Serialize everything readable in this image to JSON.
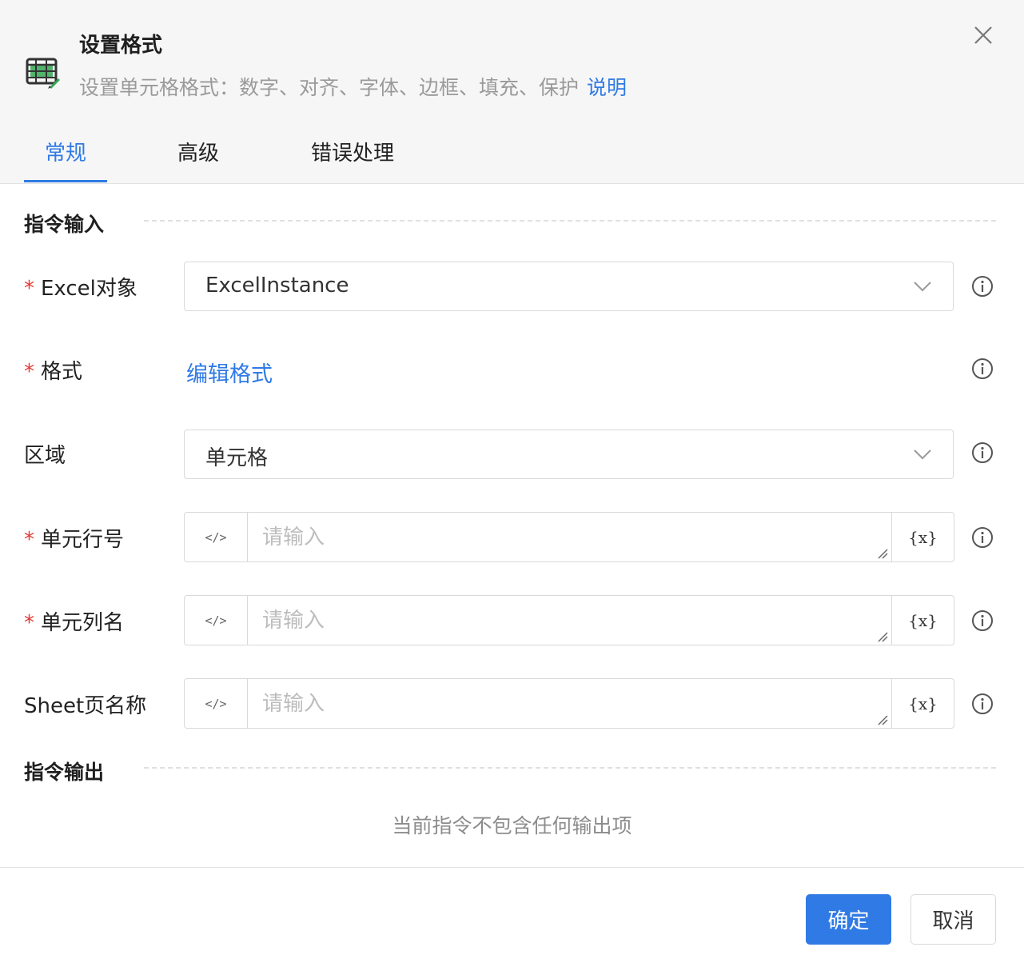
{
  "header": {
    "title": "设置格式",
    "subtitle": "设置单元格格式：数字、对齐、字体、边框、填充、保护",
    "help_link": "说明",
    "icon": "excel-format-icon",
    "close_icon": "close-icon"
  },
  "tabs": [
    {
      "label": "常规",
      "active": true
    },
    {
      "label": "高级",
      "active": false
    },
    {
      "label": "错误处理",
      "active": false
    }
  ],
  "input_section": {
    "title": "指令输入",
    "excel_object": {
      "label": "Excel对象",
      "required": true,
      "value": "ExcelInstance"
    },
    "format": {
      "label": "格式",
      "required": true,
      "link": "编辑格式"
    },
    "region": {
      "label": "区域",
      "required": false,
      "value": "单元格"
    },
    "row": {
      "label": "单元行号",
      "required": true,
      "placeholder": "请输入",
      "value": ""
    },
    "column": {
      "label": "单元列名",
      "required": true,
      "placeholder": "请输入",
      "value": ""
    },
    "sheet": {
      "label": "Sheet页名称",
      "required": false,
      "placeholder": "请输入",
      "value": ""
    },
    "code_toggle": "</>",
    "variable_button": "{x}"
  },
  "output_section": {
    "title": "指令输出",
    "empty_text": "当前指令不包含任何输出项"
  },
  "footer": {
    "ok_label": "确定",
    "cancel_label": "取消"
  },
  "colors": {
    "accent": "#2f7ae5",
    "required": "#e53935",
    "header_bg": "#f6f6f7"
  }
}
